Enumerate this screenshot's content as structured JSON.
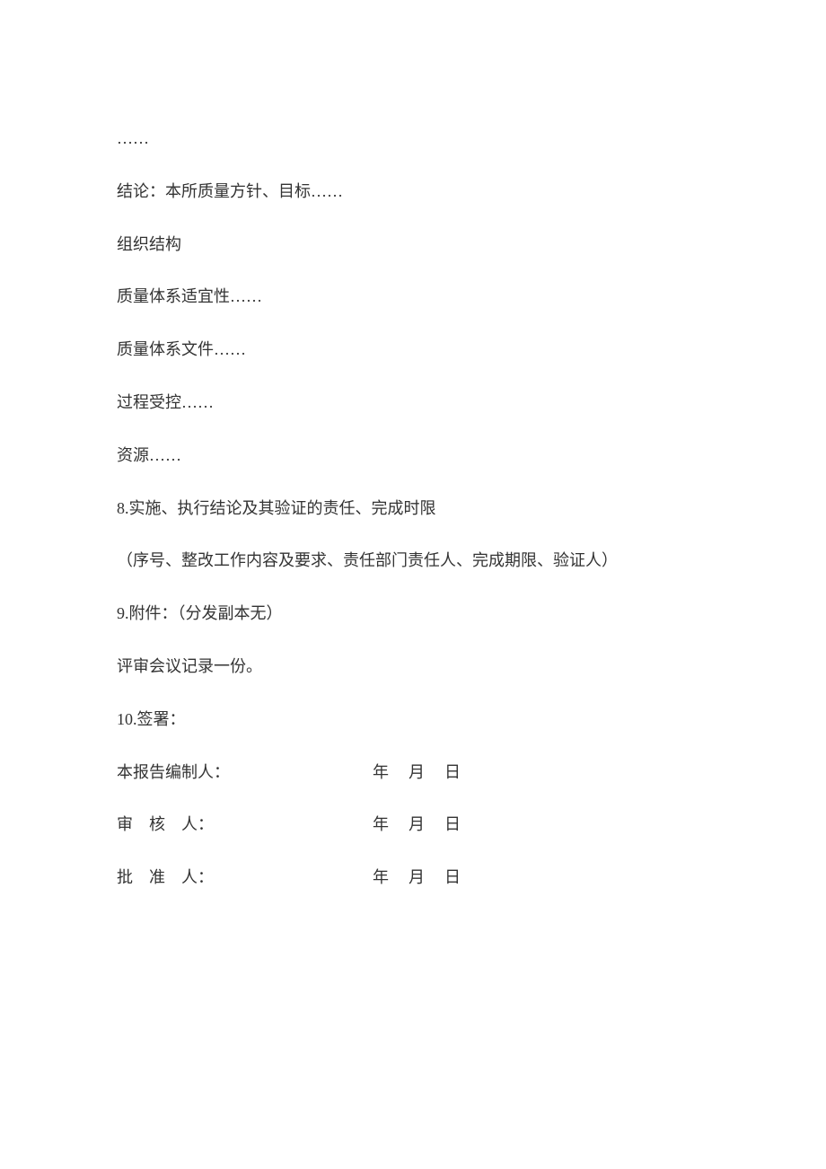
{
  "lines": {
    "ellipsis": "……",
    "conclusion": "结论：本所质量方针、目标……",
    "org": "组织结构",
    "qs_suit": "质量体系适宜性……",
    "qs_doc": "质量体系文件……",
    "process": "过程受控……",
    "resource": "资源……",
    "item8": "8.实施、执行结论及其验证的责任、完成时限",
    "item8_sub": "（序号、整改工作内容及要求、责任部门责任人、完成期限、验证人）",
    "item9": "9.附件：（分发副本无）",
    "item9_sub": "评审会议记录一份。",
    "item10": "10.签署："
  },
  "signatures": {
    "editor": {
      "label": "本报告编制人：",
      "year": "年",
      "month": "月",
      "day": "日"
    },
    "reviewer": {
      "label": "审　核　人：",
      "year": "年",
      "month": "月",
      "day": "日"
    },
    "approver": {
      "label": "批　准　人：",
      "year": "年",
      "month": "月",
      "day": "日"
    }
  }
}
